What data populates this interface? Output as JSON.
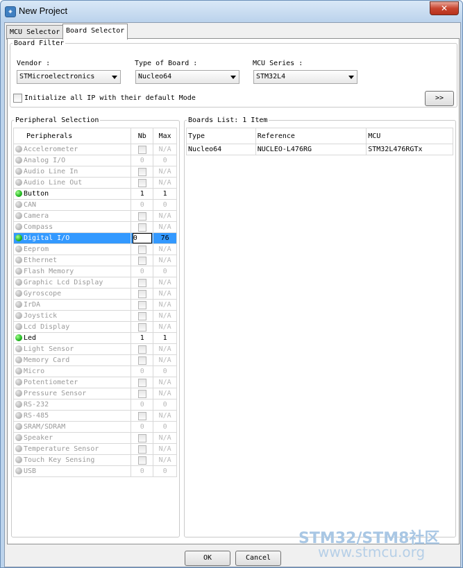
{
  "window": {
    "title": "New Project",
    "close_glyph": "✕"
  },
  "tabs": [
    {
      "label": "MCU Selector",
      "active": false
    },
    {
      "label": "Board Selector",
      "active": true
    }
  ],
  "board_filter": {
    "title": "Board Filter",
    "vendor": {
      "label": "Vendor :",
      "value": "STMicroelectronics"
    },
    "type_of_board": {
      "label": "Type of Board :",
      "value": "Nucleo64"
    },
    "mcu_series": {
      "label": "MCU Series :",
      "value": "STM32L4"
    },
    "init_checkbox": {
      "label": "Initialize all IP with their default Mode",
      "checked": false
    },
    "expand_button": ">>"
  },
  "peripheral_selection": {
    "title": "Peripheral Selection",
    "columns": [
      "Peripherals",
      "Nb",
      "Max"
    ],
    "rows": [
      {
        "name": "Accelerometer",
        "nb": "",
        "max": "N/A",
        "checkbox": true,
        "active": false
      },
      {
        "name": "Analog I/O",
        "nb": "0",
        "max": "0",
        "checkbox": false,
        "active": false
      },
      {
        "name": "Audio Line In",
        "nb": "",
        "max": "N/A",
        "checkbox": true,
        "active": false
      },
      {
        "name": "Audio Line Out",
        "nb": "",
        "max": "N/A",
        "checkbox": true,
        "active": false
      },
      {
        "name": "Button",
        "nb": "1",
        "max": "1",
        "checkbox": false,
        "active": true
      },
      {
        "name": "CAN",
        "nb": "0",
        "max": "0",
        "checkbox": false,
        "active": false
      },
      {
        "name": "Camera",
        "nb": "",
        "max": "N/A",
        "checkbox": true,
        "active": false
      },
      {
        "name": "Compass",
        "nb": "",
        "max": "N/A",
        "checkbox": true,
        "active": false
      },
      {
        "name": "Digital I/O",
        "nb": "0",
        "max": "76",
        "checkbox": false,
        "active": true,
        "selected": true
      },
      {
        "name": "Eeprom",
        "nb": "",
        "max": "N/A",
        "checkbox": true,
        "active": false
      },
      {
        "name": "Ethernet",
        "nb": "",
        "max": "N/A",
        "checkbox": true,
        "active": false
      },
      {
        "name": "Flash Memory",
        "nb": "0",
        "max": "0",
        "checkbox": false,
        "active": false
      },
      {
        "name": "Graphic Lcd Display",
        "nb": "",
        "max": "N/A",
        "checkbox": true,
        "active": false
      },
      {
        "name": "Gyroscope",
        "nb": "",
        "max": "N/A",
        "checkbox": true,
        "active": false
      },
      {
        "name": "IrDA",
        "nb": "",
        "max": "N/A",
        "checkbox": true,
        "active": false
      },
      {
        "name": "Joystick",
        "nb": "",
        "max": "N/A",
        "checkbox": true,
        "active": false
      },
      {
        "name": "Lcd Display",
        "nb": "",
        "max": "N/A",
        "checkbox": true,
        "active": false
      },
      {
        "name": "Led",
        "nb": "1",
        "max": "1",
        "checkbox": false,
        "active": true
      },
      {
        "name": "Light Sensor",
        "nb": "",
        "max": "N/A",
        "checkbox": true,
        "active": false
      },
      {
        "name": "Memory Card",
        "nb": "",
        "max": "N/A",
        "checkbox": true,
        "active": false
      },
      {
        "name": "Micro",
        "nb": "0",
        "max": "0",
        "checkbox": false,
        "active": false
      },
      {
        "name": "Potentiometer",
        "nb": "",
        "max": "N/A",
        "checkbox": true,
        "active": false
      },
      {
        "name": "Pressure Sensor",
        "nb": "",
        "max": "N/A",
        "checkbox": true,
        "active": false
      },
      {
        "name": "RS-232",
        "nb": "0",
        "max": "0",
        "checkbox": false,
        "active": false
      },
      {
        "name": "RS-485",
        "nb": "",
        "max": "N/A",
        "checkbox": true,
        "active": false
      },
      {
        "name": "SRAM/SDRAM",
        "nb": "0",
        "max": "0",
        "checkbox": false,
        "active": false
      },
      {
        "name": "Speaker",
        "nb": "",
        "max": "N/A",
        "checkbox": true,
        "active": false
      },
      {
        "name": "Temperature Sensor",
        "nb": "",
        "max": "N/A",
        "checkbox": true,
        "active": false
      },
      {
        "name": "Touch Key Sensing",
        "nb": "",
        "max": "N/A",
        "checkbox": true,
        "active": false
      },
      {
        "name": "USB",
        "nb": "0",
        "max": "0",
        "checkbox": false,
        "active": false
      }
    ]
  },
  "boards_list": {
    "title": "Boards List: 1 Item",
    "columns": [
      "Type",
      "Reference",
      "MCU"
    ],
    "rows": [
      {
        "type": "Nucleo64",
        "reference": "NUCLEO-L476RG",
        "mcu": "STM32L476RGTx"
      }
    ]
  },
  "footer": {
    "ok": "OK",
    "cancel": "Cancel"
  },
  "watermark": {
    "line1": "STM32/STM8社区",
    "line2": "www.stmcu.org"
  }
}
